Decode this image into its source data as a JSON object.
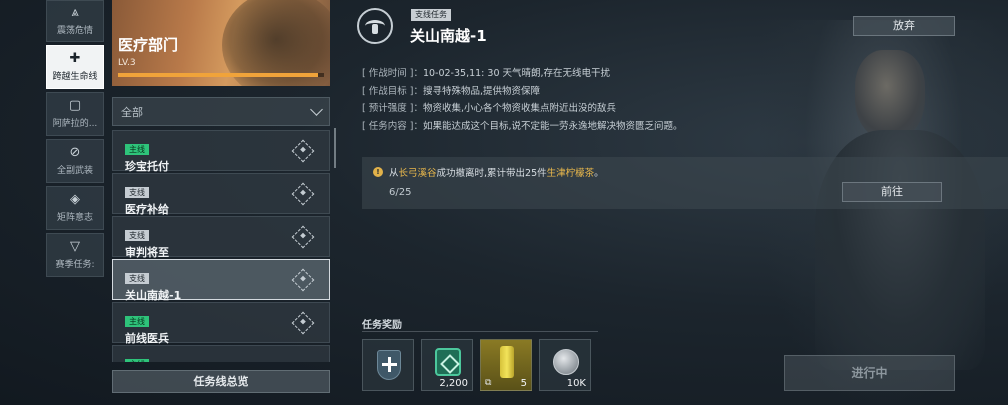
{
  "sidebar": {
    "items": [
      {
        "label": "震荡危情",
        "icon": "arrow-up-icon"
      },
      {
        "label": "跨越生命线",
        "icon": "plus-icon"
      },
      {
        "label": "阿萨拉的...",
        "icon": "square-icon"
      },
      {
        "label": "全副武装",
        "icon": "slash-circle-icon"
      },
      {
        "label": "矩阵意志",
        "icon": "diamond-icon"
      },
      {
        "label": "赛季任务:",
        "icon": "triangle-icon"
      }
    ],
    "active_index": 1
  },
  "banner": {
    "title": "医疗部门",
    "level": "LV.3",
    "progress": 0.97,
    "accent_color": "#f0a33a"
  },
  "filter": {
    "selected": "全部"
  },
  "missions": [
    {
      "tag": "主线",
      "type": "main",
      "name": "珍宝托付"
    },
    {
      "tag": "支线",
      "type": "side",
      "name": "医疗补给"
    },
    {
      "tag": "支线",
      "type": "side",
      "name": "审判将至"
    },
    {
      "tag": "支线",
      "type": "side",
      "name": "关山南越-1",
      "selected": true
    },
    {
      "tag": "主线",
      "type": "main",
      "name": "前线医兵"
    },
    {
      "tag": "主线",
      "type": "main",
      "name": ""
    }
  ],
  "overview_button": "任务线总览",
  "detail": {
    "tag": "支线任务",
    "title": "关山南越-1",
    "abandon_button": "放弃",
    "info": [
      {
        "label": "[ 作战时间 ]：",
        "value": "10-02-35,11: 30 天气晴朗,存在无线电干扰"
      },
      {
        "label": "[ 作战目标 ]：",
        "value": "搜寻特殊物品,提供物资保障"
      },
      {
        "label": "[ 预计强度 ]：",
        "value": "物资收集,小心各个物资收集点附近出没的敌兵"
      },
      {
        "label": "[ 任务内容 ]：",
        "value": "如果能达成这个目标,说不定能一劳永逸地解决物资匮乏问题。"
      }
    ],
    "goal": {
      "icon": "info-icon",
      "prefix": "从",
      "place": "长弓溪谷",
      "middle": "成功撤离时,累计带出25件",
      "item": "生津柠檬茶",
      "suffix": "。",
      "progress_text": "6/25",
      "current": 6,
      "total": 25
    },
    "goto_button": "前往"
  },
  "rewards": {
    "label": "任务奖励",
    "items": [
      {
        "icon": "medical-shield-icon",
        "count": ""
      },
      {
        "icon": "green-badge-icon",
        "count": "2,200"
      },
      {
        "icon": "lemon-tea-can-icon",
        "count": "5"
      },
      {
        "icon": "silver-coin-icon",
        "count": "10K"
      }
    ]
  },
  "status_button": "进行中"
}
